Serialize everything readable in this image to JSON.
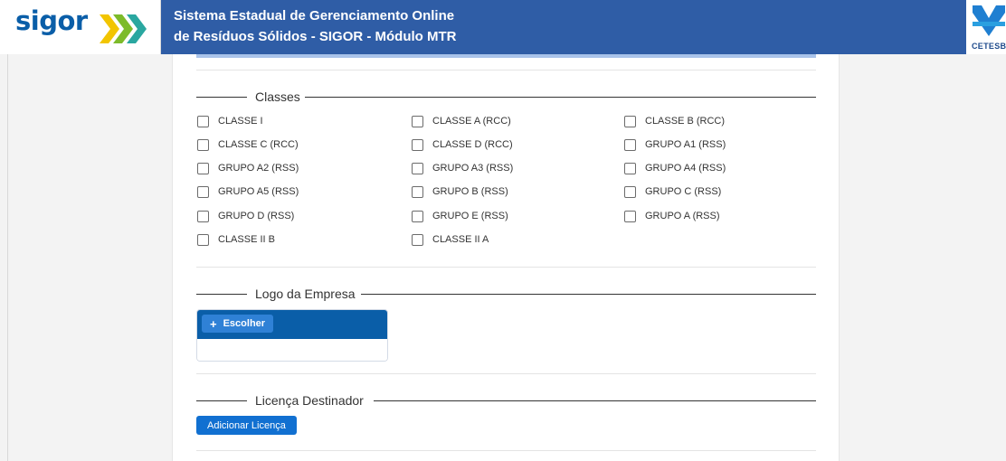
{
  "header": {
    "logo_text": "sigor",
    "title_line1": "Sistema Estadual de Gerenciamento Online",
    "title_line2": "de Resíduos Sólidos - SIGOR - Módulo MTR",
    "partner_logo_text": "CETESB"
  },
  "colors": {
    "header_bg": "#2f5da6",
    "primary": "#0a5ea8",
    "button": "#1170d1",
    "accent_strip": "#a9c3ea"
  },
  "classes": {
    "legend": "Classes",
    "items": [
      {
        "label": "CLASSE I",
        "checked": false
      },
      {
        "label": "CLASSE A (RCC)",
        "checked": false
      },
      {
        "label": "CLASSE B (RCC)",
        "checked": false
      },
      {
        "label": "CLASSE C (RCC)",
        "checked": false
      },
      {
        "label": "CLASSE D (RCC)",
        "checked": false
      },
      {
        "label": "GRUPO A1 (RSS)",
        "checked": false
      },
      {
        "label": "GRUPO A2 (RSS)",
        "checked": false
      },
      {
        "label": "GRUPO A3 (RSS)",
        "checked": false
      },
      {
        "label": "GRUPO A4 (RSS)",
        "checked": false
      },
      {
        "label": "GRUPO A5 (RSS)",
        "checked": false
      },
      {
        "label": "GRUPO B (RSS)",
        "checked": false
      },
      {
        "label": "GRUPO C (RSS)",
        "checked": false
      },
      {
        "label": "GRUPO D (RSS)",
        "checked": false
      },
      {
        "label": "GRUPO E (RSS)",
        "checked": false
      },
      {
        "label": "GRUPO A (RSS)",
        "checked": false
      },
      {
        "label": "CLASSE II B",
        "checked": false
      },
      {
        "label": "CLASSE II A",
        "checked": false
      }
    ]
  },
  "logo_empresa": {
    "legend": "Logo da Empresa",
    "choose_label": "Escolher",
    "choose_icon": "plus-icon"
  },
  "licenca": {
    "legend": "Licença Destinador",
    "add_label": "Adicionar Licença"
  }
}
